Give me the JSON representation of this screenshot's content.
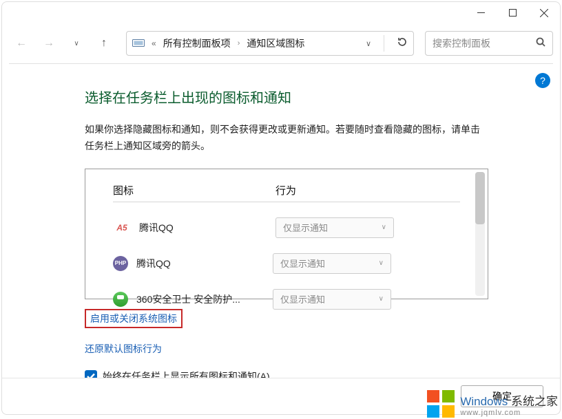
{
  "titlebar": {
    "minimize": "min",
    "maximize": "max",
    "close": "close"
  },
  "nav": {
    "back": "←",
    "forward": "→",
    "up": "↑"
  },
  "address": {
    "crumb1": "所有控制面板项",
    "crumb2": "通知区域图标"
  },
  "search": {
    "placeholder": "搜索控制面板"
  },
  "help_badge": "?",
  "page": {
    "title": "选择在任务栏上出现的图标和通知",
    "desc": "如果你选择隐藏图标和通知，则不会获得更改或更新通知。若要随时查看隐藏的图标，请单击任务栏上通知区域旁的箭头。"
  },
  "table": {
    "col_icon": "图标",
    "col_behave": "行为",
    "rows": [
      {
        "icon": "a5",
        "label": "腾讯QQ",
        "value": "仅显示通知"
      },
      {
        "icon": "php",
        "label": "腾讯QQ",
        "value": "仅显示通知"
      },
      {
        "icon": "safe",
        "label": "360安全卫士 安全防护...",
        "value": "仅显示通知"
      }
    ]
  },
  "links": {
    "toggle_system": "启用或关闭系统图标",
    "restore_default": "还原默认图标行为"
  },
  "checkbox": {
    "label": "始终在任务栏上显示所有图标和通知(A)"
  },
  "footer": {
    "ok": "确定"
  },
  "watermark": {
    "brand_en": "Windows ",
    "brand_cn": "系统之家",
    "url": "www.jqmlv.com"
  }
}
